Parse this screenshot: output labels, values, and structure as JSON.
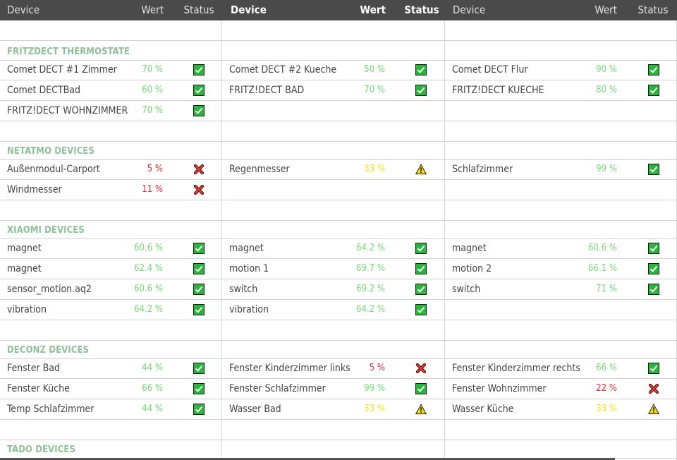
{
  "header": {
    "columns": [
      {
        "device": "Device",
        "value": "Wert",
        "status": "Status"
      },
      {
        "device": "Device",
        "value": "Wert",
        "status": "Status"
      },
      {
        "device": "Device",
        "value": "Wert",
        "status": "Status"
      }
    ]
  },
  "colors": {
    "ok": "#74db74",
    "error": "#e0313a",
    "warn": "#f2e80a",
    "section": "#8fc198",
    "header_bg": "#4a4a4a"
  },
  "sections": {
    "fritz": {
      "title": "FRITZDECT THERMOSTATE",
      "rows": [
        [
          {
            "name": "Comet DECT #1 Zimmer",
            "value": "70 %",
            "level": "ok"
          },
          {
            "name": "Comet DECT #2 Kueche",
            "value": "50 %",
            "level": "ok"
          },
          {
            "name": "Comet DECT Flur",
            "value": "90 %",
            "level": "ok"
          }
        ],
        [
          {
            "name": "Comet DECTBad",
            "value": "60 %",
            "level": "ok"
          },
          {
            "name": "FRITZ!DECT BAD",
            "value": "70 %",
            "level": "ok"
          },
          {
            "name": "FRITZ!DECT KUECHE",
            "value": "80 %",
            "level": "ok"
          }
        ],
        [
          {
            "name": "FRITZ!DECT WOHNZIMMER",
            "value": "70 %",
            "level": "ok"
          }
        ]
      ]
    },
    "netatmo": {
      "title": "NETATMO DEVICES",
      "rows": [
        [
          {
            "name": "Außenmodul-Carport",
            "value": "5 %",
            "level": "error"
          },
          {
            "name": "Regenmesser",
            "value": "33 %",
            "level": "warn"
          },
          {
            "name": "Schlafzimmer",
            "value": "99 %",
            "level": "ok"
          }
        ],
        [
          {
            "name": "Windmesser",
            "value": "11 %",
            "level": "error"
          }
        ]
      ]
    },
    "xiaomi": {
      "title": "XIAOMI DEVICES",
      "rows": [
        [
          {
            "name": "magnet",
            "value": "60.6 %",
            "level": "ok"
          },
          {
            "name": "magnet",
            "value": "64.2 %",
            "level": "ok"
          },
          {
            "name": "magnet",
            "value": "60.6 %",
            "level": "ok"
          }
        ],
        [
          {
            "name": "magnet",
            "value": "62.4 %",
            "level": "ok"
          },
          {
            "name": "motion 1",
            "value": "69.7 %",
            "level": "ok"
          },
          {
            "name": "motion 2",
            "value": "66.1 %",
            "level": "ok"
          }
        ],
        [
          {
            "name": "sensor_motion.aq2",
            "value": "60.6 %",
            "level": "ok"
          },
          {
            "name": "switch",
            "value": "69.2 %",
            "level": "ok"
          },
          {
            "name": "switch",
            "value": "71 %",
            "level": "ok"
          }
        ],
        [
          {
            "name": "vibration",
            "value": "64.2 %",
            "level": "ok"
          },
          {
            "name": "vibration",
            "value": "64.2 %",
            "level": "ok"
          }
        ]
      ]
    },
    "deconz": {
      "title": "DECONZ DEVICES",
      "rows": [
        [
          {
            "name": "Fenster Bad",
            "value": "44 %",
            "level": "ok"
          },
          {
            "name": "Fenster Kinderzimmer links",
            "value": "5 %",
            "level": "error"
          },
          {
            "name": "Fenster Kinderzimmer rechts",
            "value": "66 %",
            "level": "ok"
          }
        ],
        [
          {
            "name": "Fenster Küche",
            "value": "66 %",
            "level": "ok"
          },
          {
            "name": "Fenster Schlafzimmer",
            "value": "99 %",
            "level": "ok"
          },
          {
            "name": "Fenster Wohnzimmer",
            "value": "22 %",
            "level": "error"
          }
        ],
        [
          {
            "name": "Temp Schlafzimmer",
            "value": "44 %",
            "level": "ok"
          },
          {
            "name": "Wasser Bad",
            "value": "33 %",
            "level": "warn"
          },
          {
            "name": "Wasser Küche",
            "value": "33 %",
            "level": "warn"
          }
        ]
      ]
    },
    "tado": {
      "title": "TADO DEVICES",
      "rows": []
    }
  }
}
